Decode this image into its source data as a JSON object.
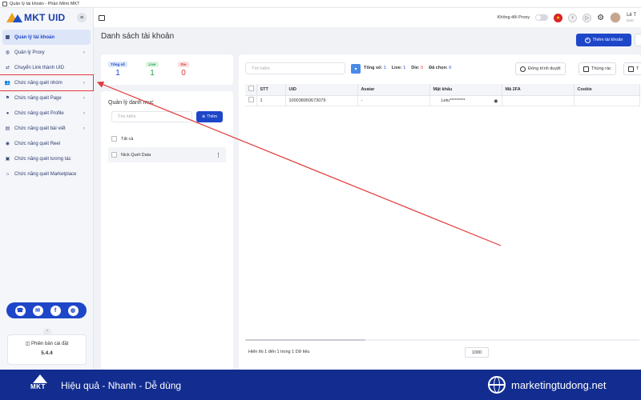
{
  "window": {
    "title": "Quản lý tài khoản - Phần Mềm MKT"
  },
  "brand": {
    "logo_text": "MKT UID"
  },
  "sidebar": {
    "items": [
      {
        "label": "Quản lý tài khoản",
        "icon": "grid-icon",
        "active": true
      },
      {
        "label": "Quản lý Proxy",
        "icon": "globe-icon",
        "chevron": true
      },
      {
        "label": "Chuyển Link thành UID",
        "icon": "swap-icon"
      },
      {
        "label": "Chức năng quét nhóm",
        "icon": "group-icon",
        "chevron": true,
        "highlighted": true
      },
      {
        "label": "Chức năng quét Page",
        "icon": "flag-icon",
        "chevron": true
      },
      {
        "label": "Chức năng quét Profile",
        "icon": "profile-icon",
        "chevron": true
      },
      {
        "label": "Chức năng quét bài viết",
        "icon": "post-icon",
        "chevron": true
      },
      {
        "label": "Chức năng quét Reel",
        "icon": "reel-icon"
      },
      {
        "label": "Chức năng quét tương tác",
        "icon": "interaction-icon"
      },
      {
        "label": "Chức năng quét Marketplace",
        "icon": "marketplace-icon"
      }
    ],
    "version_label": "Phiên bản cài đặt",
    "version": "5.4.4"
  },
  "topbar": {
    "proxy_label": "Không đổi Proxy",
    "user_name": "Lê T",
    "user_sub": "lamt"
  },
  "page": {
    "title": "Danh sách tài khoản",
    "add_account": "Thêm tài khoản"
  },
  "stats": {
    "total_label": "Tổng số",
    "total": "1",
    "live_label": "Live",
    "live": "1",
    "die_label": "Die",
    "die": "0"
  },
  "categories": {
    "title": "Quản lý danh mục",
    "search_placeholder": "Tìm kiếm",
    "add_label": "Thêm",
    "all_label": "Tất cả",
    "items": [
      {
        "name": "Nick Quét Data"
      }
    ]
  },
  "main": {
    "search_placeholder": "Tìm kiếm",
    "summary": {
      "total_label": "Tổng số:",
      "total": "1",
      "live_label": "Live:",
      "live": "1",
      "die_label": "Die:",
      "die": "0",
      "selected_label": "Đã chọn:",
      "selected": "0"
    },
    "close_browser": "Đóng trình duyệt",
    "trash": "Thùng rác",
    "more_btn": "T",
    "columns": [
      "STT",
      "UID",
      "Avatar",
      "Mật khẩu",
      "Mã 2FA",
      "Cookie"
    ],
    "rows": [
      {
        "stt": "1",
        "uid": "100038950673079",
        "avatar": "-",
        "password": "Letu*********",
        "twofa": "",
        "cookie": ""
      }
    ],
    "footer_info": "Hiển thị 1 đến 1 trong 1 Dữ liệu",
    "page_size": "1000"
  },
  "banner": {
    "logo_text": "MKT",
    "slogan": "Hiệu quả - Nhanh - Dễ dùng",
    "url": "marketingtudong.net"
  },
  "colors": {
    "primary": "#1d46c9",
    "banner": "#122d8f",
    "annotation": "#e23a3a"
  }
}
